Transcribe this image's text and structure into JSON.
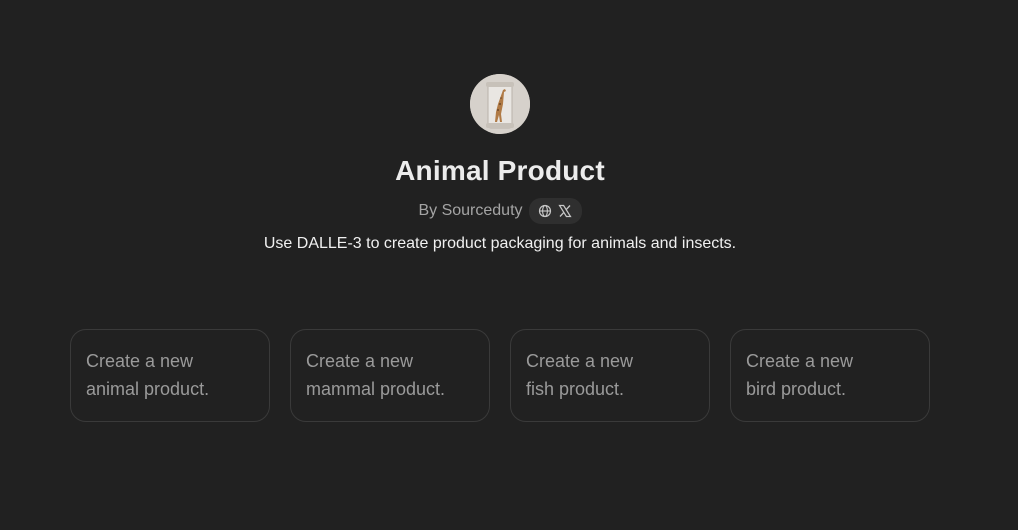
{
  "gpt": {
    "title": "Animal Product",
    "byline": "By Sourceduty",
    "description": "Use DALLE-3 to create product packaging for animals and insects.",
    "links": [
      {
        "icon": "globe-icon"
      },
      {
        "icon": "x-logo-icon"
      }
    ]
  },
  "prompts": [
    {
      "line1": "Create a new",
      "line2": "animal product."
    },
    {
      "line1": "Create a new",
      "line2": "mammal product."
    },
    {
      "line1": "Create a new",
      "line2": "fish product."
    },
    {
      "line1": "Create a new",
      "line2": "bird product."
    }
  ],
  "colors": {
    "background": "#212121",
    "card_border": "#3a3a3a",
    "muted_text": "#9a9a9a"
  }
}
